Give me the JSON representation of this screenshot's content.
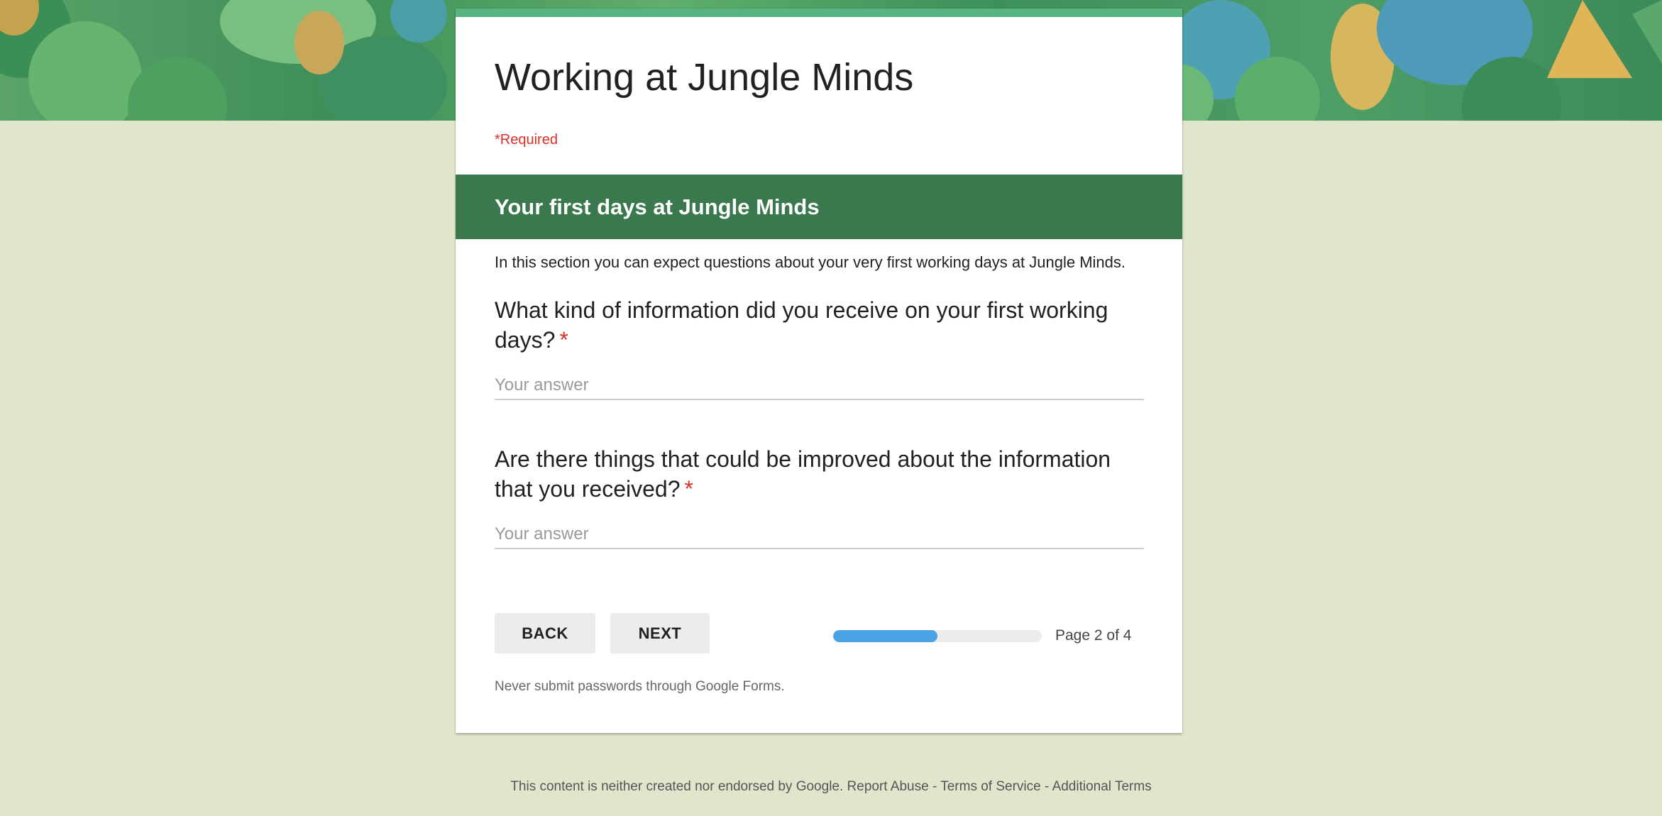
{
  "colors": {
    "page_background": "#e0e6cc",
    "card_accent": "#58b582",
    "section_header": "#3a784e",
    "required": "#d93025",
    "progress_fill": "#4aa3e4",
    "progress_track": "#ececec"
  },
  "form": {
    "title": "Working at Jungle Minds",
    "required_note": "*Required"
  },
  "section": {
    "title": "Your first days at Jungle Minds",
    "description": "In this section you can expect questions about your very first working days at Jungle Minds."
  },
  "questions": [
    {
      "title": "What kind of information did you receive on your first working days?",
      "required_marker": "*",
      "placeholder": "Your answer"
    },
    {
      "title": "Are there things that could be improved about the information that you received?",
      "required_marker": "*",
      "placeholder": "Your answer"
    }
  ],
  "navigation": {
    "back_label": "BACK",
    "next_label": "NEXT"
  },
  "progress": {
    "page_label": "Page 2 of 4",
    "fraction": 0.5
  },
  "warning": "Never submit passwords through Google Forms.",
  "footer": {
    "notice": "This content is neither created nor endorsed by Google.",
    "links": [
      "Report Abuse",
      "Terms of Service",
      "Additional Terms"
    ],
    "separator": "-"
  }
}
